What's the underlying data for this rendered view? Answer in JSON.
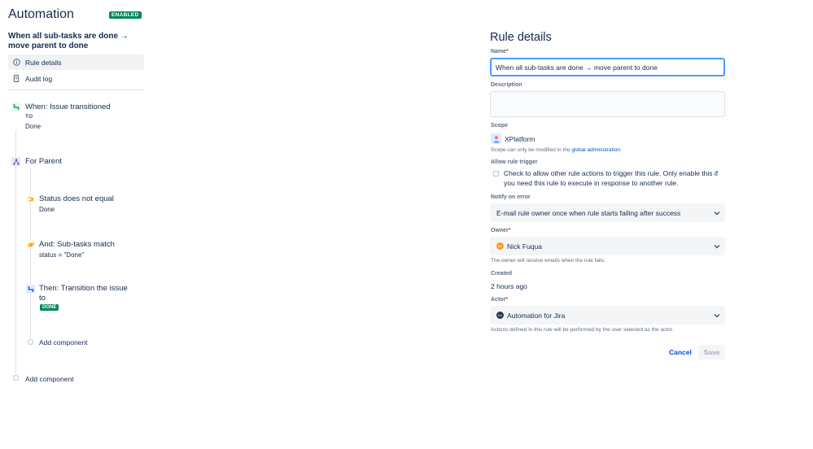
{
  "header": {
    "title": "Automation",
    "status_badge": "ENABLED",
    "rule_name": "When all sub-tasks are done → move parent to done"
  },
  "nav": {
    "rule_details": "Rule details",
    "audit_log": "Audit log"
  },
  "flow": {
    "trigger": {
      "title": "When: Issue transitioned",
      "tag": "TO",
      "value": "Done"
    },
    "branch": {
      "title": "For Parent"
    },
    "condition1": {
      "title": "Status does not equal",
      "value": "Done"
    },
    "condition2": {
      "title": "And: Sub-tasks match",
      "value": "status = \"Done\""
    },
    "action": {
      "title_line1": "Then: Transition the issue",
      "title_line2": "to",
      "lozenge": "DONE"
    },
    "inner_add": "Add component",
    "outer_add": "Add component"
  },
  "details": {
    "title": "Rule details",
    "name_label": "Name",
    "required_mark": "*",
    "name_value": "When all sub-tasks are done → move parent to done",
    "description_label": "Description",
    "scope_label": "Scope",
    "scope_value": "XPlatform",
    "scope_help_prefix": "Scope can only be modified in the",
    "scope_help_link": "global administration",
    "scope_help_suffix": ".",
    "allow_trigger_label": "Allow rule trigger",
    "allow_trigger_text": "Check to allow other rule actions to trigger this rule. Only enable this if you need this rule to execute in response to another rule.",
    "notify_label": "Notify on error",
    "notify_value": "E-mail rule owner once when rule starts failing after success",
    "owner_label": "Owner",
    "owner_value": "Nick Fuqua",
    "owner_initials": "NF",
    "owner_help": "The owner will receive emails when the rule fails.",
    "created_label": "Created",
    "created_value": "2 hours ago",
    "actor_label": "Actor",
    "actor_value": "Automation for Jira",
    "actor_initials": "AJ",
    "actor_help": "Actions defined in this rule will be performed by the user selected as the actor.",
    "cancel_label": "Cancel",
    "save_label": "Save"
  },
  "colors": {
    "accent": "#0052cc",
    "success": "#00875a",
    "focus": "#4c9aff",
    "text": "#172b4d",
    "subtle": "#5e6c84"
  }
}
